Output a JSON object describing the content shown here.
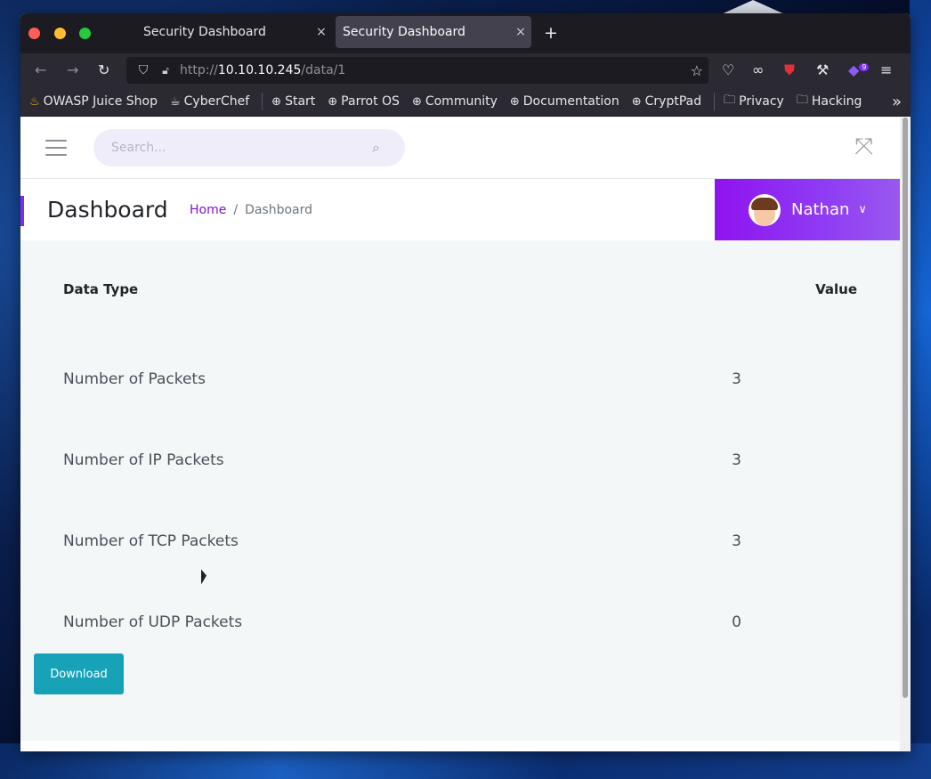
{
  "browser": {
    "tabs": [
      {
        "title": "Security Dashboard",
        "active": false
      },
      {
        "title": "Security Dashboard",
        "active": true
      }
    ],
    "close_glyph": "×",
    "new_tab_glyph": "+",
    "url_prefix": "http://",
    "url_host": "10.10.10.245",
    "url_path": "/data/1",
    "bookmarks": [
      {
        "label": "OWASP Juice Shop",
        "icon": "juice-icon"
      },
      {
        "label": "CyberChef",
        "icon": "chef-icon"
      },
      {
        "label": "Start",
        "icon": "globe-icon"
      },
      {
        "label": "Parrot OS",
        "icon": "globe-icon"
      },
      {
        "label": "Community",
        "icon": "globe-icon"
      },
      {
        "label": "Documentation",
        "icon": "globe-icon"
      },
      {
        "label": "CryptPad",
        "icon": "globe-icon"
      },
      {
        "label": "Privacy",
        "icon": "folder-icon"
      },
      {
        "label": "Hacking",
        "icon": "folder-icon"
      }
    ],
    "extension_badge": "9"
  },
  "topbar": {
    "search_placeholder": "Search..."
  },
  "header": {
    "title": "Dashboard",
    "breadcrumb_home": "Home",
    "breadcrumb_sep": "/",
    "breadcrumb_current": "Dashboard",
    "user_name": "Nathan"
  },
  "table": {
    "headers": {
      "type": "Data Type",
      "value": "Value"
    },
    "rows": [
      {
        "label": "Number of Packets",
        "value": "3"
      },
      {
        "label": "Number of IP Packets",
        "value": "3"
      },
      {
        "label": "Number of TCP Packets",
        "value": "3"
      },
      {
        "label": "Number of UDP Packets",
        "value": "0"
      }
    ]
  },
  "actions": {
    "download_label": "Download"
  },
  "colors": {
    "accent": "#8f13ee",
    "link": "#7b16d0",
    "download": "#17a2b8"
  }
}
